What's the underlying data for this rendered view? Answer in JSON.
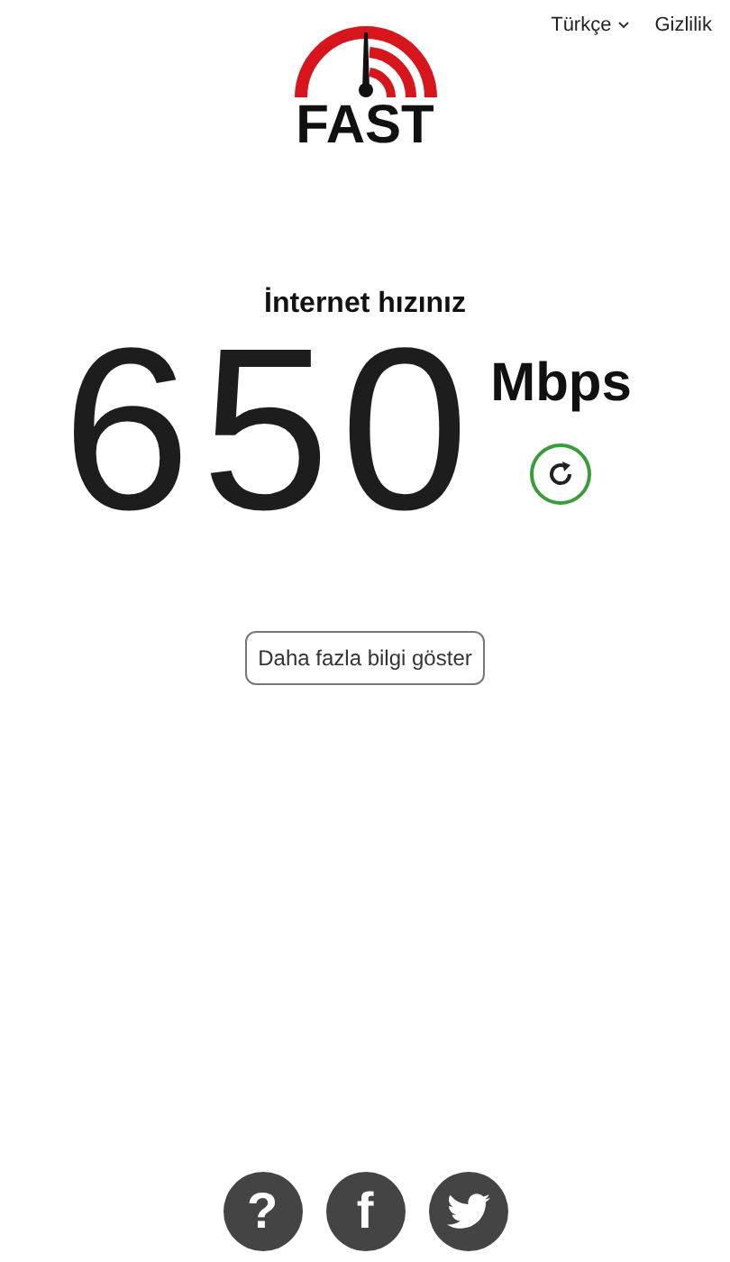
{
  "header": {
    "logo_text": "FAST",
    "nav": [
      {
        "kind": "dropdown",
        "label": "Türkçe"
      },
      {
        "kind": "link",
        "label": "Gizlilik"
      }
    ]
  },
  "result": {
    "title": "İnternet hızınız",
    "speed": "650",
    "unit": "Mbps"
  },
  "more_button": {
    "label": "Daha fazla bilgi göster"
  },
  "footer": [
    {
      "kind": "help",
      "label": "?"
    },
    {
      "kind": "facebook",
      "label": "f"
    },
    {
      "kind": "twitter"
    }
  ]
}
